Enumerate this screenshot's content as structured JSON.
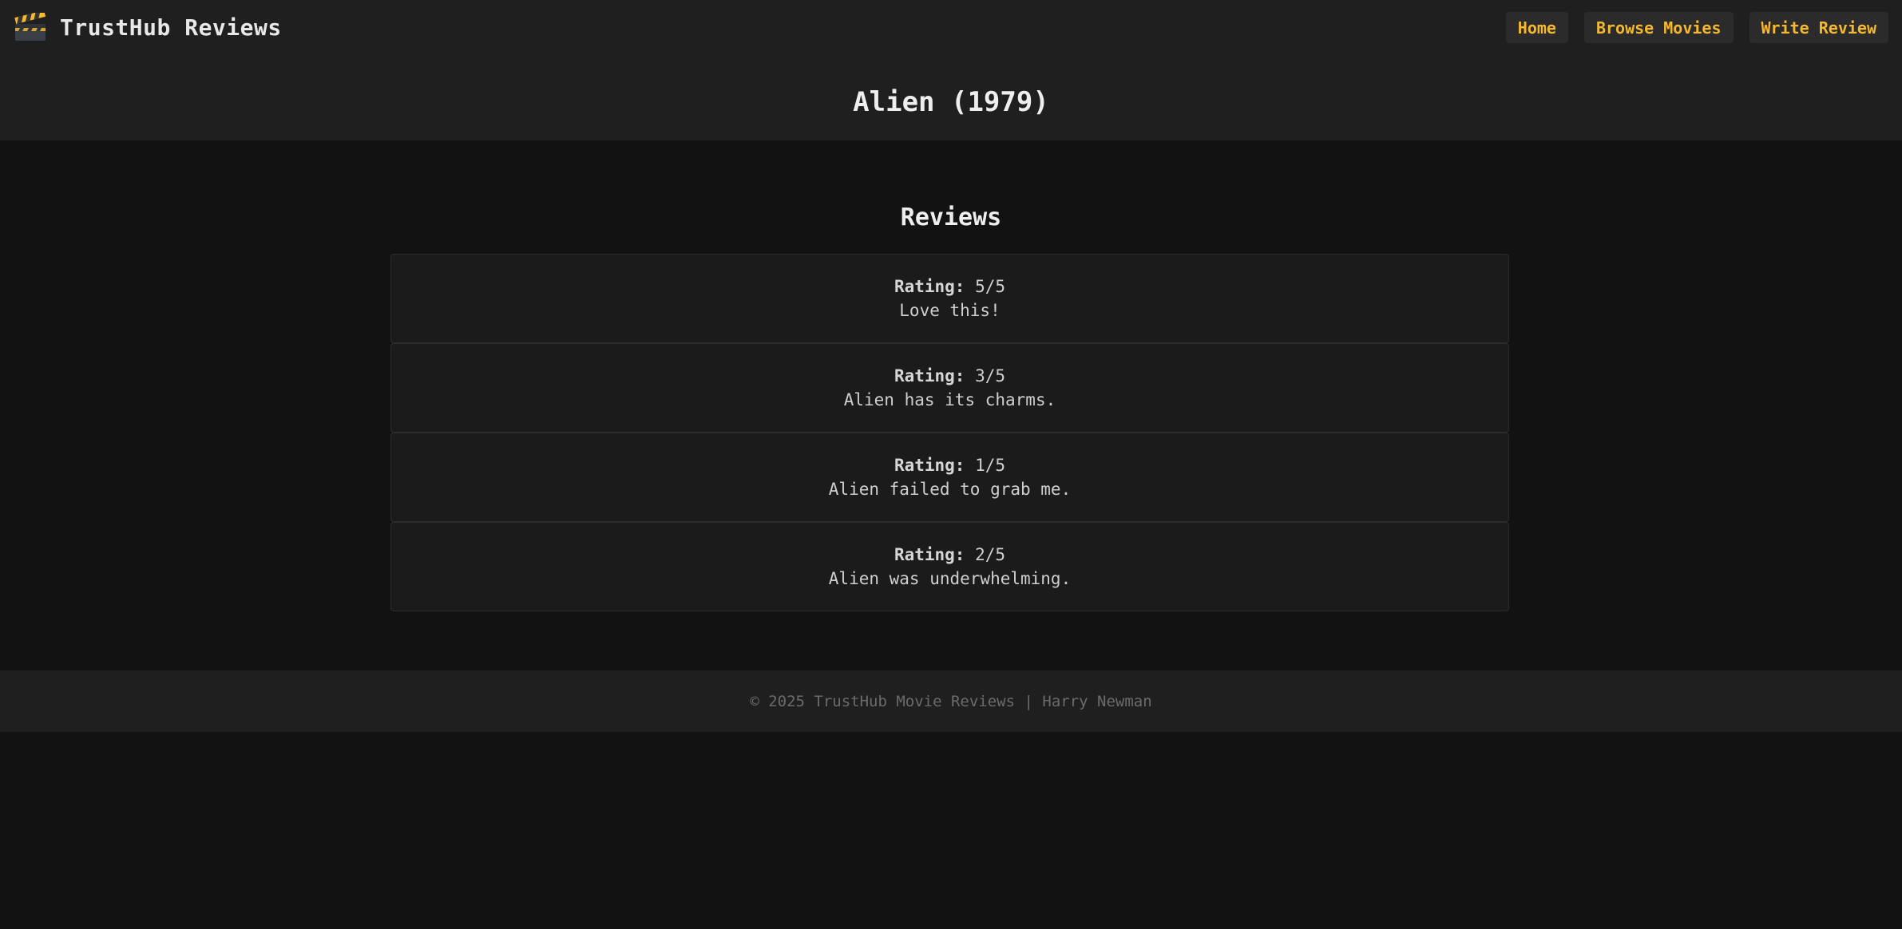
{
  "brand": {
    "icon": "clapperboard-icon",
    "name": "TrustHub Reviews"
  },
  "nav": {
    "home": "Home",
    "browse": "Browse Movies",
    "write": "Write Review"
  },
  "movie": {
    "title": "Alien (1979)"
  },
  "reviews": {
    "heading": "Reviews",
    "rating_label": "Rating:",
    "items": [
      {
        "rating": "5/5",
        "text": "Love this!"
      },
      {
        "rating": "3/5",
        "text": "Alien has its charms."
      },
      {
        "rating": "1/5",
        "text": "Alien failed to grab me."
      },
      {
        "rating": "2/5",
        "text": "Alien was underwhelming."
      }
    ]
  },
  "footer": {
    "text": "© 2025 TrustHub Movie Reviews | Harry Newman"
  },
  "colors": {
    "accent": "#f5b82e",
    "background": "#121212",
    "header": "#1f1f1f"
  }
}
